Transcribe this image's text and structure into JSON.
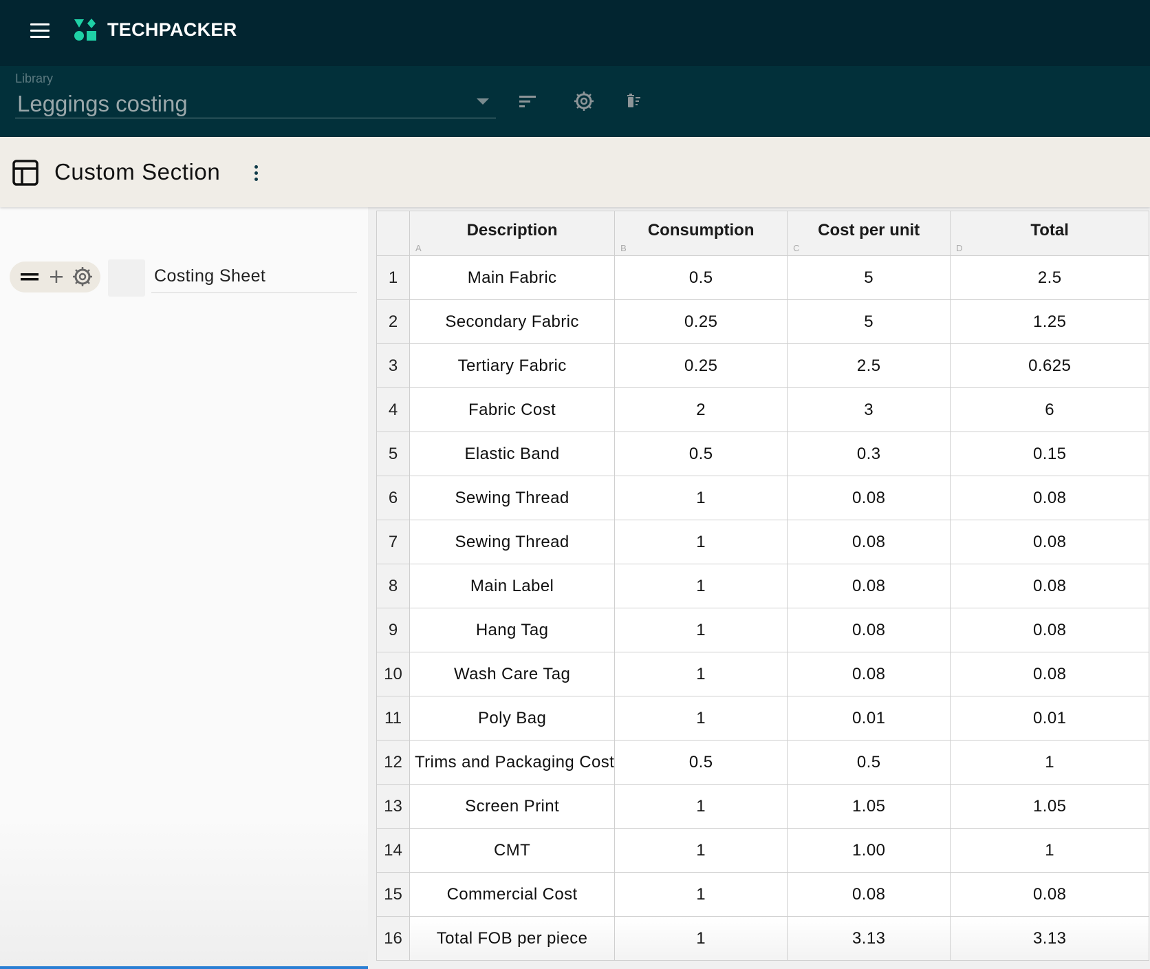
{
  "topbar": {
    "brand": "TECHPACKER",
    "menu_icon": "hamburger-menu-icon",
    "logo_icon": "techpacker-logo-shapes",
    "brand_color": "#1fd1a6"
  },
  "library": {
    "label": "Library",
    "selected": "Leggings costing",
    "tools": [
      "sort-icon",
      "gear-icon",
      "delete-list-icon"
    ]
  },
  "section": {
    "title": "Custom Section",
    "icon": "layout-template-icon",
    "menu_icon": "kebab-menu-icon"
  },
  "sidebar": {
    "controls": [
      "drag-handle-icon",
      "add-icon",
      "gear-icon"
    ],
    "sheet_name": "Costing Sheet"
  },
  "sheet": {
    "columns": [
      {
        "letter": "A",
        "label": "Description"
      },
      {
        "letter": "B",
        "label": "Consumption"
      },
      {
        "letter": "C",
        "label": "Cost per unit"
      },
      {
        "letter": "D",
        "label": "Total"
      }
    ],
    "rows": [
      {
        "n": "1",
        "description": "Main Fabric",
        "consumption": "0.5",
        "cost": "5",
        "total": "2.5"
      },
      {
        "n": "2",
        "description": "Secondary Fabric",
        "consumption": "0.25",
        "cost": "5",
        "total": "1.25"
      },
      {
        "n": "3",
        "description": "Tertiary Fabric",
        "consumption": "0.25",
        "cost": "2.5",
        "total": "0.625"
      },
      {
        "n": "4",
        "description": "Fabric Cost",
        "consumption": "2",
        "cost": "3",
        "total": "6"
      },
      {
        "n": "5",
        "description": "Elastic Band",
        "consumption": "0.5",
        "cost": "0.3",
        "total": "0.15"
      },
      {
        "n": "6",
        "description": "Sewing Thread",
        "consumption": "1",
        "cost": "0.08",
        "total": "0.08"
      },
      {
        "n": "7",
        "description": "Sewing Thread",
        "consumption": "1",
        "cost": "0.08",
        "total": "0.08"
      },
      {
        "n": "8",
        "description": "Main Label",
        "consumption": "1",
        "cost": "0.08",
        "total": "0.08"
      },
      {
        "n": "9",
        "description": "Hang Tag",
        "consumption": "1",
        "cost": "0.08",
        "total": "0.08"
      },
      {
        "n": "10",
        "description": "Wash Care Tag",
        "consumption": "1",
        "cost": "0.08",
        "total": "0.08"
      },
      {
        "n": "11",
        "description": "Poly Bag",
        "consumption": "1",
        "cost": "0.01",
        "total": "0.01"
      },
      {
        "n": "12",
        "description": "Trims and Packaging Cost",
        "consumption": "0.5",
        "cost": "0.5",
        "total": "1"
      },
      {
        "n": "13",
        "description": "Screen Print",
        "consumption": "1",
        "cost": "1.05",
        "total": "1.05"
      },
      {
        "n": "14",
        "description": "CMT",
        "consumption": "1",
        "cost": "1.00",
        "total": "1"
      },
      {
        "n": "15",
        "description": "Commercial Cost",
        "consumption": "1",
        "cost": "0.08",
        "total": "0.08"
      },
      {
        "n": "16",
        "description": "Total FOB per piece",
        "consumption": "1",
        "cost": "3.13",
        "total": "3.13"
      }
    ]
  }
}
